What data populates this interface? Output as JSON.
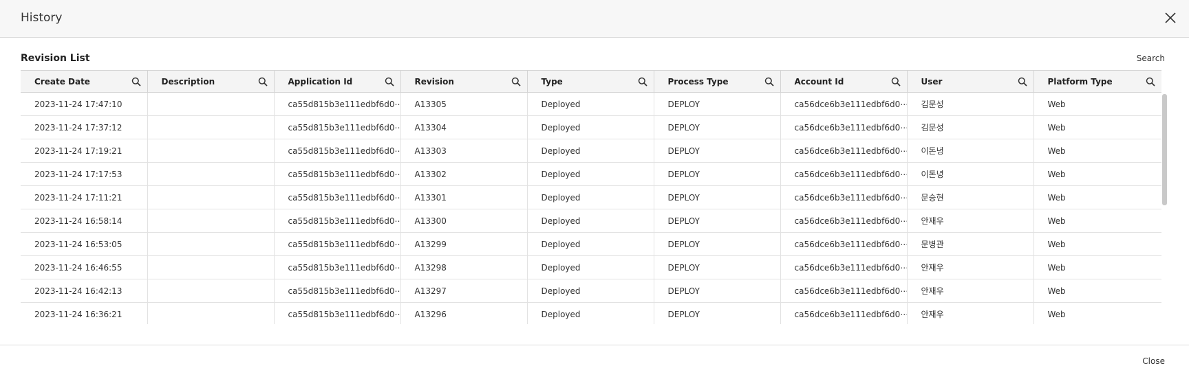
{
  "modal": {
    "title": "History",
    "close_icon": "close-icon",
    "footer_close_label": "Close"
  },
  "revision_list": {
    "title": "Revision List",
    "search_label": "Search",
    "search_icon": "search-icon",
    "columns": [
      "Create Date",
      "Description",
      "Application Id",
      "Revision",
      "Type",
      "Process Type",
      "Account Id",
      "User",
      "Platform Type"
    ],
    "rows": [
      [
        "2023-11-24 17:47:10",
        "",
        "ca55d815b3e111edbf6d0⋯",
        "A13305",
        "Deployed",
        "DEPLOY",
        "ca56dce6b3e111edbf6d0⋯",
        "김문성",
        "Web"
      ],
      [
        "2023-11-24 17:37:12",
        "",
        "ca55d815b3e111edbf6d0⋯",
        "A13304",
        "Deployed",
        "DEPLOY",
        "ca56dce6b3e111edbf6d0⋯",
        "김문성",
        "Web"
      ],
      [
        "2023-11-24 17:19:21",
        "",
        "ca55d815b3e111edbf6d0⋯",
        "A13303",
        "Deployed",
        "DEPLOY",
        "ca56dce6b3e111edbf6d0⋯",
        "이돈녕",
        "Web"
      ],
      [
        "2023-11-24 17:17:53",
        "",
        "ca55d815b3e111edbf6d0⋯",
        "A13302",
        "Deployed",
        "DEPLOY",
        "ca56dce6b3e111edbf6d0⋯",
        "이돈녕",
        "Web"
      ],
      [
        "2023-11-24 17:11:21",
        "",
        "ca55d815b3e111edbf6d0⋯",
        "A13301",
        "Deployed",
        "DEPLOY",
        "ca56dce6b3e111edbf6d0⋯",
        "문승현",
        "Web"
      ],
      [
        "2023-11-24 16:58:14",
        "",
        "ca55d815b3e111edbf6d0⋯",
        "A13300",
        "Deployed",
        "DEPLOY",
        "ca56dce6b3e111edbf6d0⋯",
        "안재우",
        "Web"
      ],
      [
        "2023-11-24 16:53:05",
        "",
        "ca55d815b3e111edbf6d0⋯",
        "A13299",
        "Deployed",
        "DEPLOY",
        "ca56dce6b3e111edbf6d0⋯",
        "문병관",
        "Web"
      ],
      [
        "2023-11-24 16:46:55",
        "",
        "ca55d815b3e111edbf6d0⋯",
        "A13298",
        "Deployed",
        "DEPLOY",
        "ca56dce6b3e111edbf6d0⋯",
        "안재우",
        "Web"
      ],
      [
        "2023-11-24 16:42:13",
        "",
        "ca55d815b3e111edbf6d0⋯",
        "A13297",
        "Deployed",
        "DEPLOY",
        "ca56dce6b3e111edbf6d0⋯",
        "안재우",
        "Web"
      ],
      [
        "2023-11-24 16:36:21",
        "",
        "ca55d815b3e111edbf6d0⋯",
        "A13296",
        "Deployed",
        "DEPLOY",
        "ca56dce6b3e111edbf6d0⋯",
        "안재우",
        "Web"
      ]
    ]
  }
}
